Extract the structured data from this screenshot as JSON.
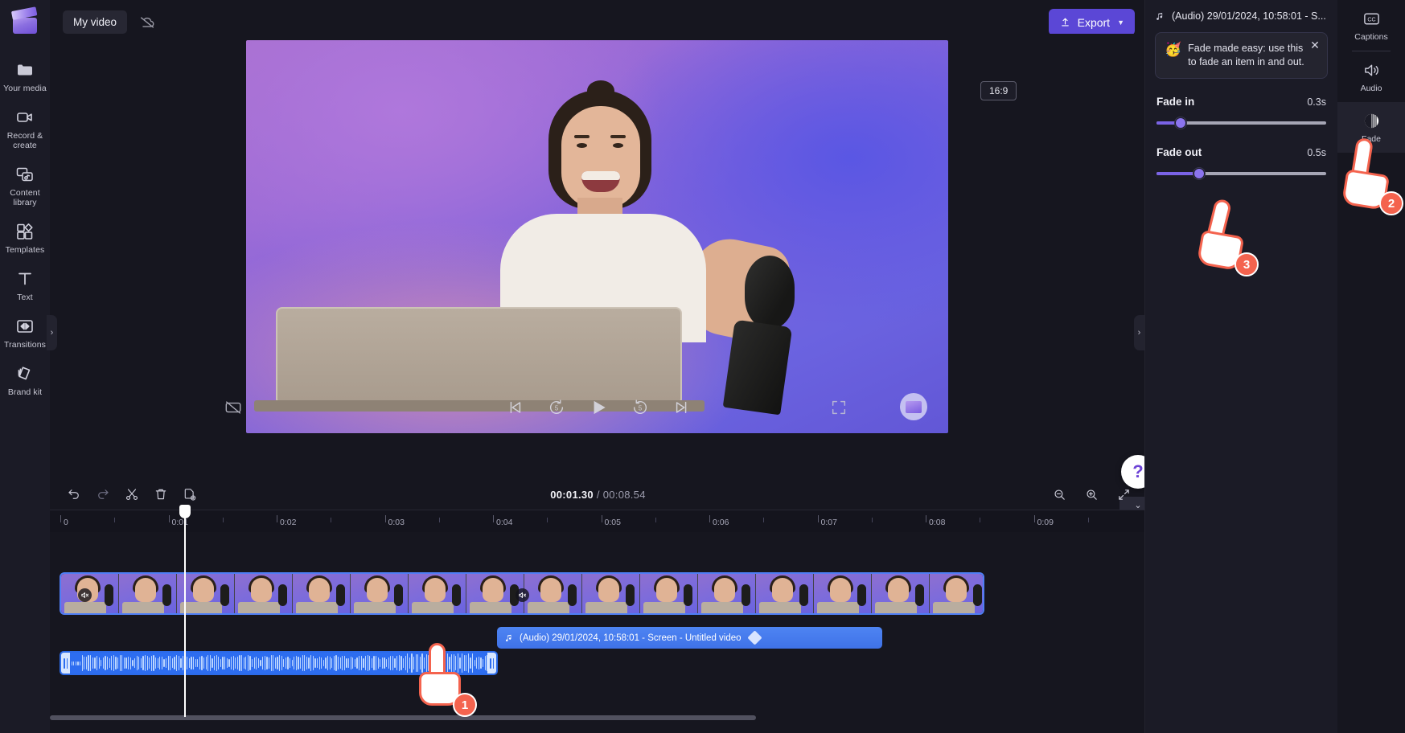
{
  "app": {
    "project_name": "My video",
    "cloud_status_icon": "cloud-off-icon",
    "export_label": "Export"
  },
  "left_rail": {
    "logo_icon": "clipchamp-logo-icon",
    "items": [
      {
        "icon": "folder-icon",
        "label": "Your media"
      },
      {
        "icon": "video-camera-icon",
        "label": "Record & create"
      },
      {
        "icon": "content-library-icon",
        "label": "Content library"
      },
      {
        "icon": "templates-icon",
        "label": "Templates"
      },
      {
        "icon": "text-icon",
        "label": "Text"
      },
      {
        "icon": "transitions-icon",
        "label": "Transitions"
      },
      {
        "icon": "brand-kit-icon",
        "label": "Brand kit"
      }
    ]
  },
  "preview": {
    "aspect_ratio": "16:9",
    "watermark_icon": "clipchamp-watermark-icon",
    "controls": {
      "captions_off_icon": "captions-off-icon",
      "skip_start_icon": "skip-to-start-icon",
      "rewind_label": "5",
      "play_icon": "play-icon",
      "forward_label": "5",
      "skip_end_icon": "skip-to-end-icon",
      "fullscreen_icon": "fullscreen-icon"
    },
    "help_label": "?",
    "collapse_icon": "chevron-down-icon"
  },
  "timeline": {
    "tools": [
      {
        "icon": "undo-icon",
        "name": "undo"
      },
      {
        "icon": "redo-icon",
        "name": "redo"
      },
      {
        "icon": "split-icon",
        "name": "split"
      },
      {
        "icon": "delete-icon",
        "name": "delete"
      },
      {
        "icon": "duplicate-icon",
        "name": "duplicate"
      }
    ],
    "current_time": "00:01.30",
    "separator": "/",
    "total_time": "00:08.54",
    "zoom_tools": [
      {
        "icon": "zoom-out-icon",
        "name": "zoom-out"
      },
      {
        "icon": "zoom-in-icon",
        "name": "zoom-in"
      },
      {
        "icon": "fit-icon",
        "name": "fit-to-screen"
      }
    ],
    "ruler_labels": [
      "0",
      "0:01",
      "0:02",
      "0:03",
      "0:04",
      "0:05",
      "0:06",
      "0:07",
      "0:08",
      "0:09"
    ],
    "audio_clip_label": "(Audio) 29/01/2024, 10:58:01 - Screen - Untitled video",
    "audio_clip_icon": "music-note-icon",
    "mute_icon": "mute-icon"
  },
  "properties": {
    "header_title": "(Audio) 29/01/2024, 10:58:01 - S...",
    "header_icon": "music-note-icon",
    "callout": {
      "emoji": "🥳",
      "text": "Fade made easy: use this to fade an item in and out.",
      "close_icon": "close-icon"
    },
    "fade_in": {
      "label": "Fade in",
      "value": "0.3s",
      "percent": 14
    },
    "fade_out": {
      "label": "Fade out",
      "value": "0.5s",
      "percent": 25
    }
  },
  "right_rail": {
    "items": [
      {
        "icon": "captions-icon",
        "label": "Captions",
        "active": false
      },
      {
        "icon": "audio-icon",
        "label": "Audio",
        "active": false
      },
      {
        "icon": "fade-icon",
        "label": "Fade",
        "active": true
      }
    ]
  },
  "annotations": {
    "step1": "1",
    "step2": "2",
    "step3": "3"
  },
  "colors": {
    "accent": "#5b47d6",
    "slider_fill": "#7a63e6",
    "clip_blue": "#3f72e8",
    "annotation": "#f4634e"
  }
}
